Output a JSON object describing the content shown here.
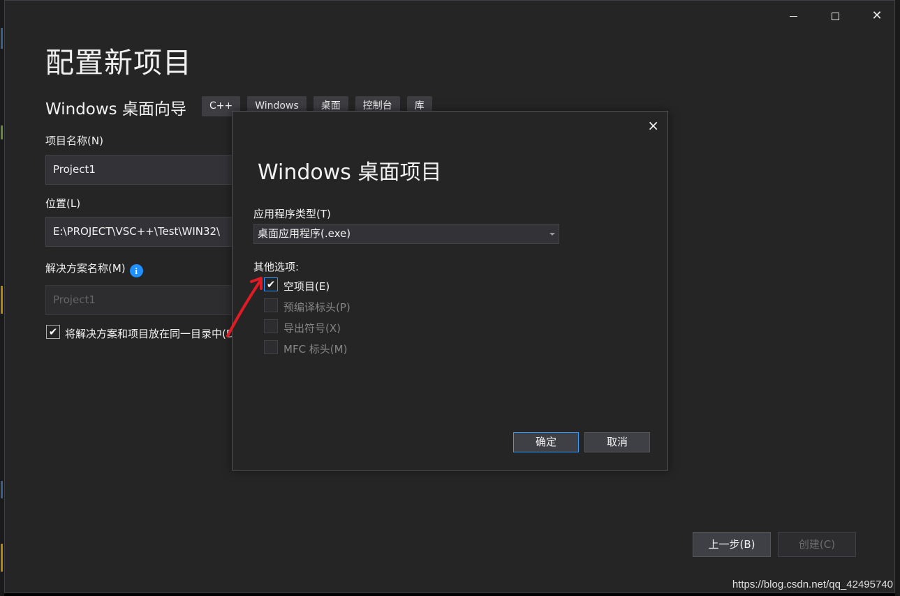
{
  "window": {
    "title": "配置新项目",
    "subtitle": "Windows 桌面向导",
    "tags": [
      "C++",
      "Windows",
      "桌面",
      "控制台",
      "库"
    ],
    "controls": {
      "minimize_icon": "minimize-icon",
      "maximize_icon": "maximize-icon",
      "close_icon": "close-icon"
    }
  },
  "form": {
    "project_name_label": "项目名称(N)",
    "project_name_value": "Project1",
    "location_label": "位置(L)",
    "location_value": "E:\\PROJECT\\VSC++\\Test\\WIN32\\",
    "solution_name_label": "解决方案名称(M)",
    "solution_name_value": "Project1",
    "same_dir_label": "将解决方案和项目放在同一目录中(D)",
    "same_dir_checked": true
  },
  "footer": {
    "back_label": "上一步(B)",
    "create_label": "创建(C)"
  },
  "dialog": {
    "close_glyph": "×",
    "title": "Windows 桌面项目",
    "app_type_label": "应用程序类型(T)",
    "app_type_value": "桌面应用程序(.exe)",
    "options_label": "其他选项:",
    "options": [
      {
        "label": "空项目(E)",
        "checked": true,
        "enabled": true
      },
      {
        "label": "预编译标头(P)",
        "checked": false,
        "enabled": false
      },
      {
        "label": "导出符号(X)",
        "checked": false,
        "enabled": false
      },
      {
        "label": "MFC 标头(M)",
        "checked": false,
        "enabled": false
      }
    ],
    "ok_label": "确定",
    "cancel_label": "取消"
  },
  "watermark": "https://blog.csdn.net/qq_42495740",
  "colors": {
    "accent": "#3399ff",
    "arrow": "#e01b24",
    "background": "#252526"
  }
}
